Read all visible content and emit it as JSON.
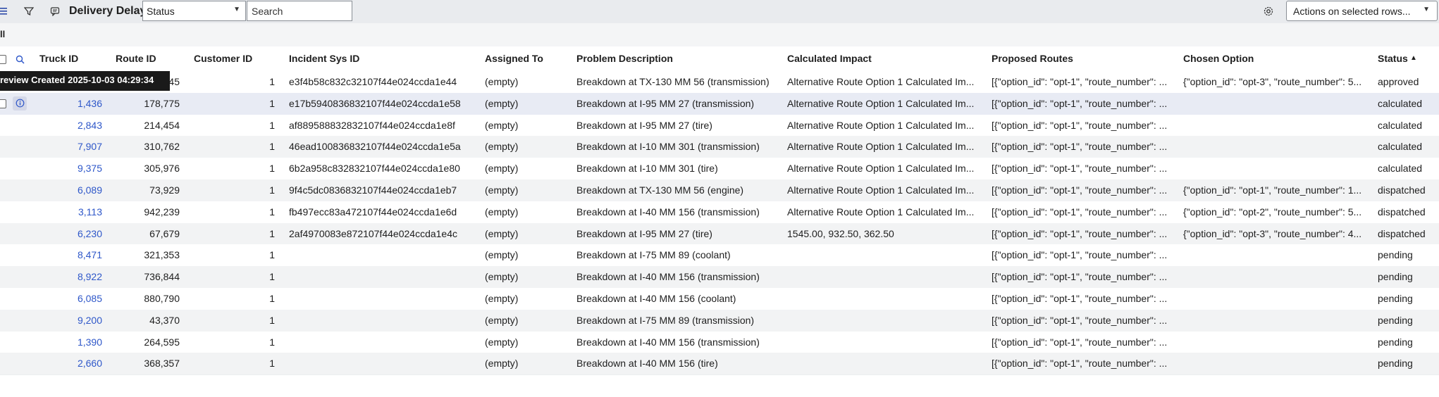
{
  "toolbar": {
    "title": "Delivery Delays",
    "filter_select_value": "Status",
    "search_placeholder": "Search",
    "actions_label": "Actions on selected rows..."
  },
  "subbar": {
    "text": "ll"
  },
  "tooltip": {
    "text": "review Created 2025-10-03 04:29:34"
  },
  "columns": [
    "Truck ID",
    "Route ID",
    "Customer ID",
    "Incident Sys ID",
    "Assigned To",
    "Problem Description",
    "Calculated Impact",
    "Proposed Routes",
    "Chosen Option",
    "Status"
  ],
  "sort_indicator": "▲",
  "rows": [
    {
      "truck": "",
      "route": "45",
      "customer": "1",
      "sysid": "e3f4b58c832c32107f44e024ccda1e44",
      "assigned": "(empty)",
      "problem": "Breakdown at TX-130 MM 56 (transmission)",
      "impact": "Alternative Route Option 1 Calculated Im...",
      "proposed": "[{\"option_id\": \"opt-1\", \"route_number\": ...",
      "chosen": "{\"option_id\": \"opt-3\", \"route_number\": 5...",
      "status": "approved"
    },
    {
      "truck": "1,436",
      "route": "178,775",
      "customer": "1",
      "sysid": "e17b5940836832107f44e024ccda1e58",
      "assigned": "(empty)",
      "problem": "Breakdown at I-95 MM 27 (transmission)",
      "impact": "Alternative Route Option 1 Calculated Im...",
      "proposed": "[{\"option_id\": \"opt-1\", \"route_number\": ...",
      "chosen": "",
      "status": "calculated"
    },
    {
      "truck": "2,843",
      "route": "214,454",
      "customer": "1",
      "sysid": "af889588832832107f44e024ccda1e8f",
      "assigned": "(empty)",
      "problem": "Breakdown at I-95 MM 27 (tire)",
      "impact": "Alternative Route Option 1 Calculated Im...",
      "proposed": "[{\"option_id\": \"opt-1\", \"route_number\": ...",
      "chosen": "",
      "status": "calculated"
    },
    {
      "truck": "7,907",
      "route": "310,762",
      "customer": "1",
      "sysid": "46ead100836832107f44e024ccda1e5a",
      "assigned": "(empty)",
      "problem": "Breakdown at I-10 MM 301 (transmission)",
      "impact": "Alternative Route Option 1 Calculated Im...",
      "proposed": "[{\"option_id\": \"opt-1\", \"route_number\": ...",
      "chosen": "",
      "status": "calculated"
    },
    {
      "truck": "9,375",
      "route": "305,976",
      "customer": "1",
      "sysid": "6b2a958c832832107f44e024ccda1e80",
      "assigned": "(empty)",
      "problem": "Breakdown at I-10 MM 301 (tire)",
      "impact": "Alternative Route Option 1 Calculated Im...",
      "proposed": "[{\"option_id\": \"opt-1\", \"route_number\": ...",
      "chosen": "",
      "status": "calculated"
    },
    {
      "truck": "6,089",
      "route": "73,929",
      "customer": "1",
      "sysid": "9f4c5dc0836832107f44e024ccda1eb7",
      "assigned": "(empty)",
      "problem": "Breakdown at TX-130 MM 56 (engine)",
      "impact": "Alternative Route Option 1 Calculated Im...",
      "proposed": "[{\"option_id\": \"opt-1\", \"route_number\": ...",
      "chosen": "{\"option_id\": \"opt-1\", \"route_number\": 1...",
      "status": "dispatched"
    },
    {
      "truck": "3,113",
      "route": "942,239",
      "customer": "1",
      "sysid": "fb497ecc83a472107f44e024ccda1e6d",
      "assigned": "(empty)",
      "problem": "Breakdown at I-40 MM 156 (transmission)",
      "impact": "Alternative Route Option 1 Calculated Im...",
      "proposed": "[{\"option_id\": \"opt-1\", \"route_number\": ...",
      "chosen": "{\"option_id\": \"opt-2\", \"route_number\": 5...",
      "status": "dispatched"
    },
    {
      "truck": "6,230",
      "route": "67,679",
      "customer": "1",
      "sysid": "2af4970083e872107f44e024ccda1e4c",
      "assigned": "(empty)",
      "problem": "Breakdown at I-95 MM 27 (tire)",
      "impact": "1545.00, 932.50, 362.50",
      "proposed": "[{\"option_id\": \"opt-1\", \"route_number\": ...",
      "chosen": "{\"option_id\": \"opt-3\", \"route_number\": 4...",
      "status": "dispatched"
    },
    {
      "truck": "8,471",
      "route": "321,353",
      "customer": "1",
      "sysid": "",
      "assigned": "(empty)",
      "problem": "Breakdown at I-75 MM 89 (coolant)",
      "impact": "",
      "proposed": "[{\"option_id\": \"opt-1\", \"route_number\": ...",
      "chosen": "",
      "status": "pending"
    },
    {
      "truck": "8,922",
      "route": "736,844",
      "customer": "1",
      "sysid": "",
      "assigned": "(empty)",
      "problem": "Breakdown at I-40 MM 156 (transmission)",
      "impact": "",
      "proposed": "[{\"option_id\": \"opt-1\", \"route_number\": ...",
      "chosen": "",
      "status": "pending"
    },
    {
      "truck": "6,085",
      "route": "880,790",
      "customer": "1",
      "sysid": "",
      "assigned": "(empty)",
      "problem": "Breakdown at I-40 MM 156 (coolant)",
      "impact": "",
      "proposed": "[{\"option_id\": \"opt-1\", \"route_number\": ...",
      "chosen": "",
      "status": "pending"
    },
    {
      "truck": "9,200",
      "route": "43,370",
      "customer": "1",
      "sysid": "",
      "assigned": "(empty)",
      "problem": "Breakdown at I-75 MM 89 (transmission)",
      "impact": "",
      "proposed": "[{\"option_id\": \"opt-1\", \"route_number\": ...",
      "chosen": "",
      "status": "pending"
    },
    {
      "truck": "1,390",
      "route": "264,595",
      "customer": "1",
      "sysid": "",
      "assigned": "(empty)",
      "problem": "Breakdown at I-40 MM 156 (transmission)",
      "impact": "",
      "proposed": "[{\"option_id\": \"opt-1\", \"route_number\": ...",
      "chosen": "",
      "status": "pending"
    },
    {
      "truck": "2,660",
      "route": "368,357",
      "customer": "1",
      "sysid": "",
      "assigned": "(empty)",
      "problem": "Breakdown at I-40 MM 156 (tire)",
      "impact": "",
      "proposed": "[{\"option_id\": \"opt-1\", \"route_number\": ...",
      "chosen": "",
      "status": "pending"
    }
  ],
  "icons": {
    "menu": "hamburger-menu-icon",
    "filter": "funnel-filter-icon",
    "list": "chat-list-icon",
    "settings": "gear-icon",
    "search_col": "search-icon",
    "info": "info-icon"
  },
  "colors": {
    "link": "#2e57c9",
    "toolbar_bg": "#e9ebee",
    "tooltip_bg": "#1a1a1a",
    "highlight_row": "#e8ebf4"
  }
}
